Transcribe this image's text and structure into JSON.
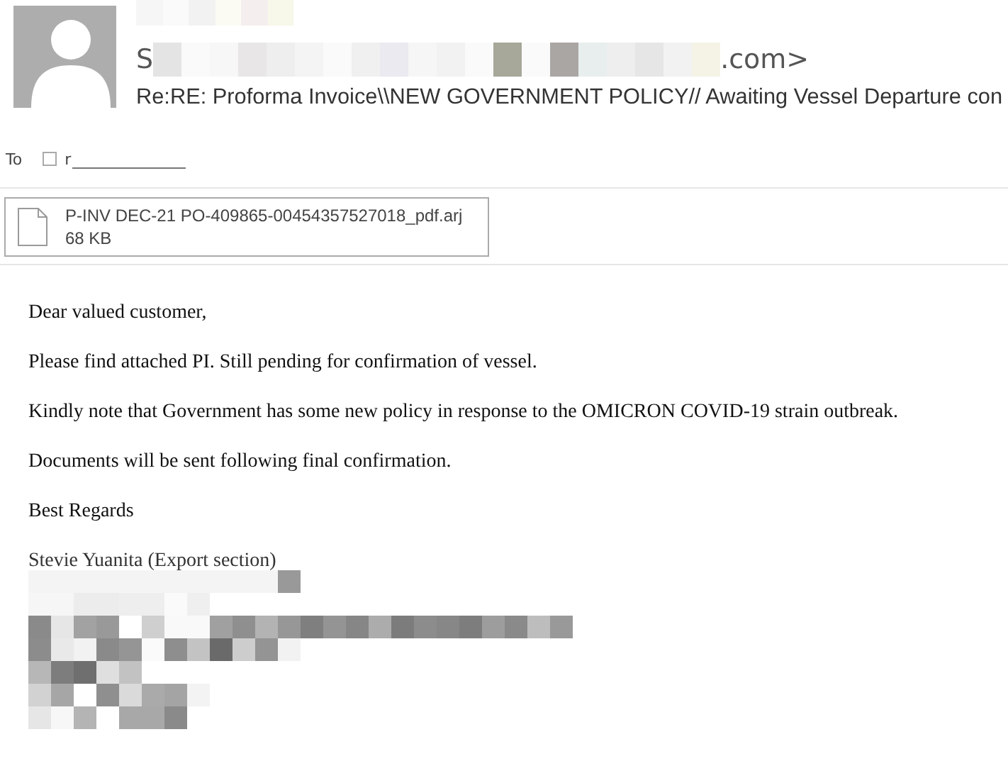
{
  "sender": {
    "address_start": "S",
    "address_end": ".com>"
  },
  "subject": "Re:RE: Proforma Invoice\\\\NEW GOVERNMENT POLICY// Awaiting Vessel Departure con",
  "recipient": {
    "label": "To",
    "name_start": "r",
    "checked": false
  },
  "attachment": {
    "name": "P-INV DEC-21 PO-409865-00454357527018_pdf.arj",
    "size": "68 KB"
  },
  "body": [
    "Dear valued customer,",
    "Please find attached PI. Still pending for confirmation of vessel.",
    "Kindly note that Government has some new policy in response to the OMICRON COVID-19 strain outbreak.",
    "Documents will be sent following final confirmation.",
    "Best Regards"
  ],
  "signature": "Stevie Yuanita (Export section)"
}
